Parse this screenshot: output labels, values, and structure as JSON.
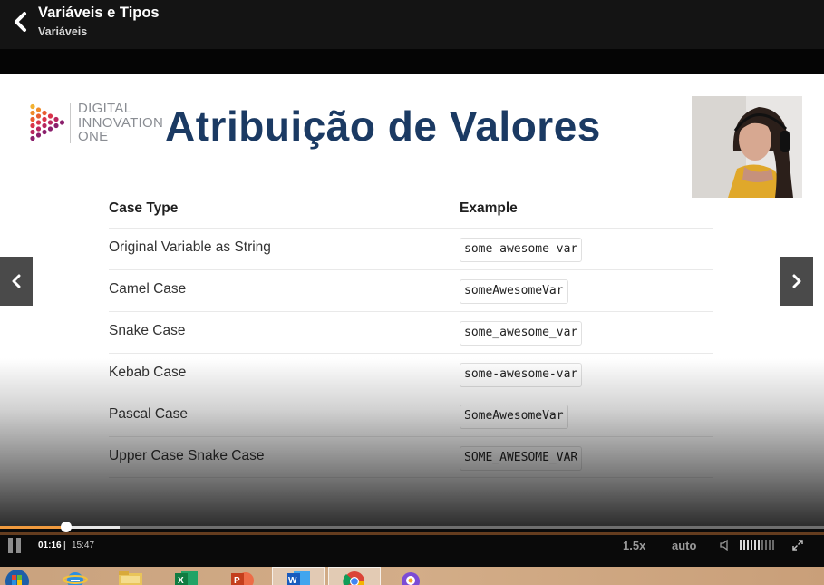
{
  "header": {
    "title": "Variáveis e Tipos",
    "subtitle": "Variáveis"
  },
  "slide": {
    "logo_text": [
      "DIGITAL",
      "INNOVATION",
      "ONE"
    ],
    "title": "Atribuição de Valores",
    "table": {
      "headers": [
        "Case Type",
        "Example"
      ],
      "rows": [
        {
          "case": "Original Variable as String",
          "example": "some awesome var"
        },
        {
          "case": "Camel Case",
          "example": "someAwesomeVar"
        },
        {
          "case": "Snake Case",
          "example": "some_awesome_var"
        },
        {
          "case": "Kebab Case",
          "example": "some-awesome-var"
        },
        {
          "case": "Pascal Case",
          "example": "SomeAwesomeVar"
        },
        {
          "case": "Upper Case Snake Case",
          "example": "SOME_AWESOME_VAR"
        }
      ]
    }
  },
  "player": {
    "current_time": "01:16",
    "separator": "|",
    "duration": "15:47",
    "speed": "1.5x",
    "quality": "auto",
    "progress_fraction": 0.0803,
    "buffered_fraction": 0.145,
    "volume_fraction": 0.6
  },
  "icons": {
    "back": "chevron-left-icon",
    "prev": "chevron-left-icon",
    "next": "chevron-right-icon",
    "pause": "pause-icon",
    "volume": "speaker-icon",
    "fullscreen": "expand-icon"
  },
  "colors": {
    "title_blue": "#1b3a63",
    "progress_orange": "#f09a3e",
    "topbar": "#141414"
  },
  "taskbar": {
    "apps": [
      "start",
      "internet-explorer",
      "file-explorer",
      "excel",
      "powerpoint",
      "word",
      "chrome",
      "app"
    ]
  }
}
